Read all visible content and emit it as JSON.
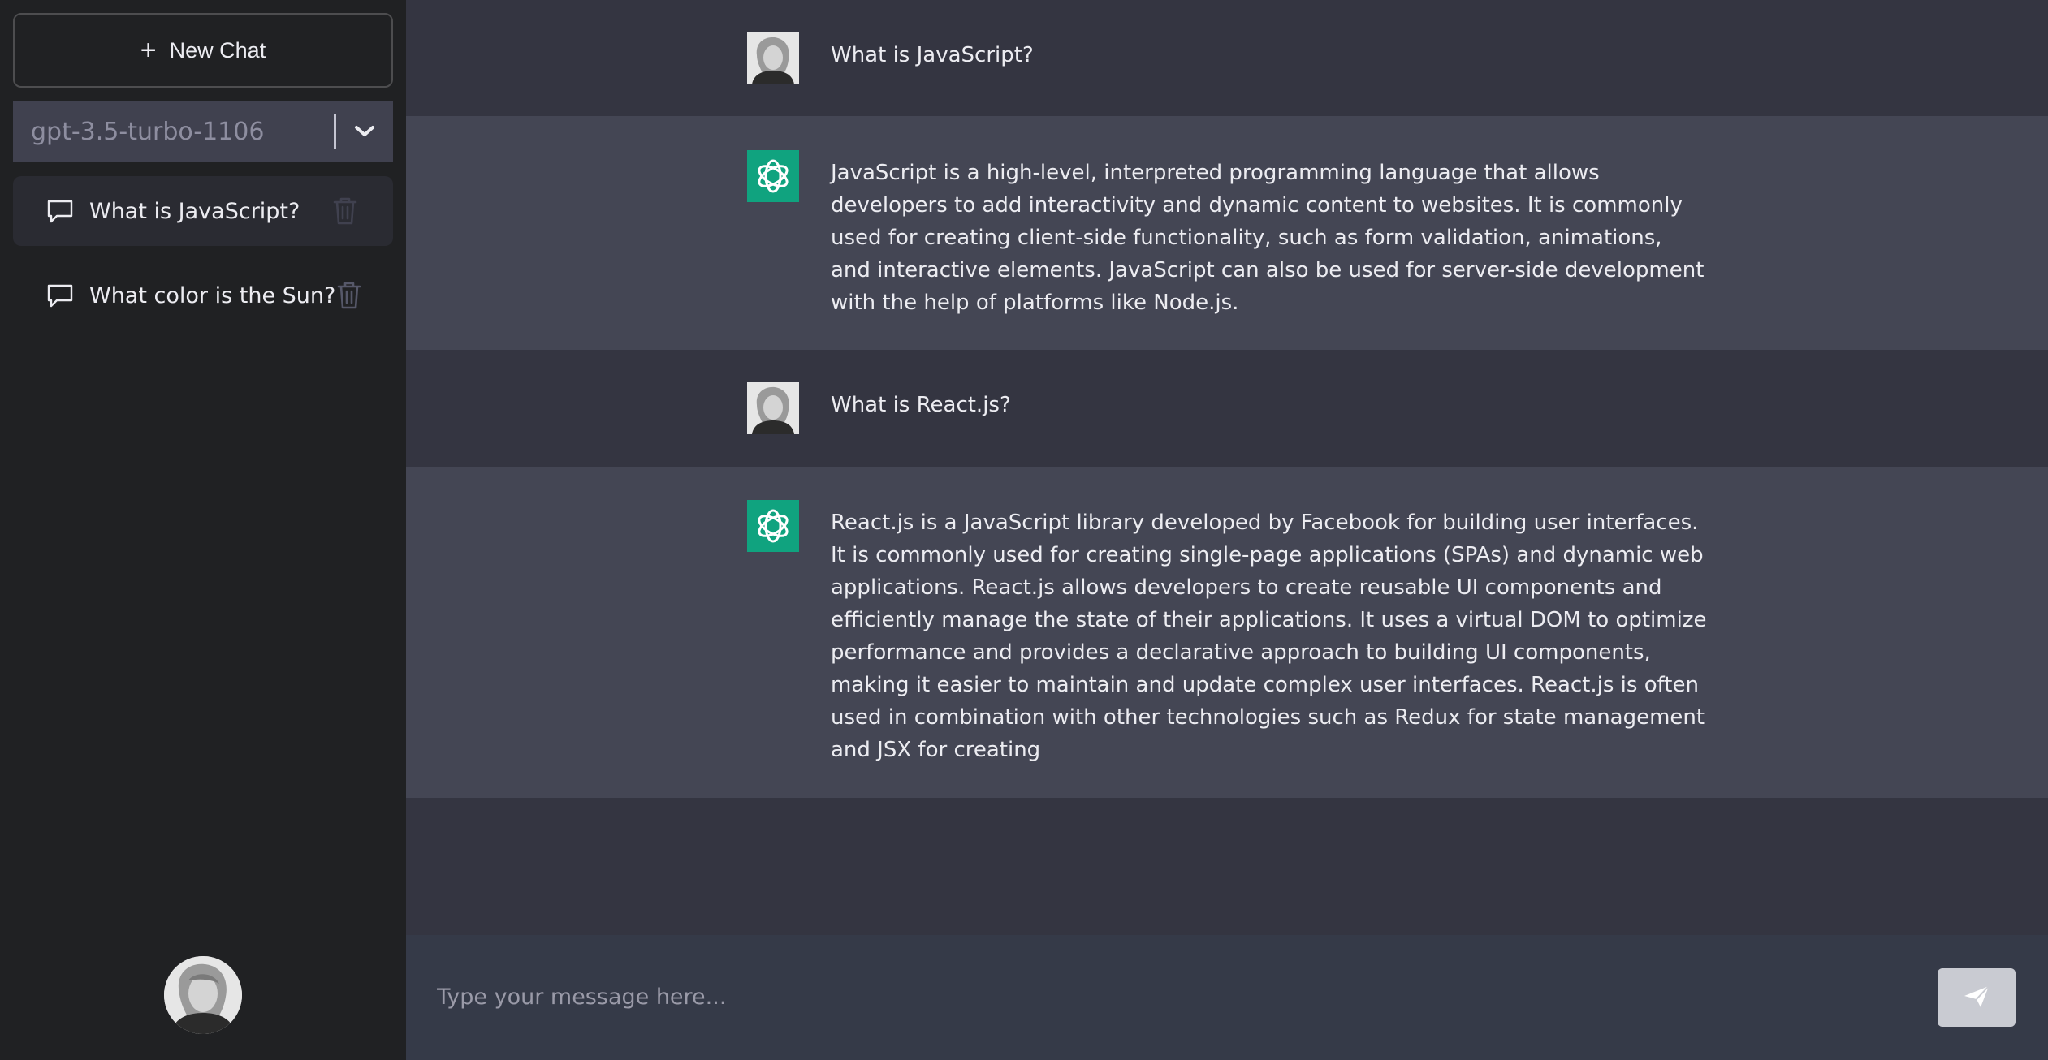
{
  "sidebar": {
    "new_chat_label": "New Chat",
    "model": "gpt-3.5-turbo-1106",
    "conversations": [
      {
        "label": "What is JavaScript?",
        "active": true
      },
      {
        "label": "What color is the Sun?",
        "active": false
      }
    ]
  },
  "messages": [
    {
      "role": "user",
      "text": "What is JavaScript?"
    },
    {
      "role": "assistant",
      "text": "JavaScript is a high-level, interpreted programming language that allows developers to add interactivity and dynamic content to websites. It is commonly used for creating client-side functionality, such as form validation, animations, and interactive elements. JavaScript can also be used for server-side development with the help of platforms like Node.js."
    },
    {
      "role": "user",
      "text": "What is React.js?"
    },
    {
      "role": "assistant",
      "text": "React.js is a JavaScript library developed by Facebook for building user interfaces. It is commonly used for creating single-page applications (SPAs) and dynamic web applications. React.js allows developers to create reusable UI components and efficiently manage the state of their applications. It uses a virtual DOM to optimize performance and provides a declarative approach to building UI components, making it easier to maintain and update complex user interfaces. React.js is often used in combination with other technologies such as Redux for state management and JSX for creating"
    }
  ],
  "input": {
    "placeholder": "Type your message here...",
    "value": ""
  },
  "colors": {
    "accent": "#10a37f",
    "sidebar_bg": "#202123",
    "main_bg": "#343541",
    "bot_bg": "#444654"
  }
}
